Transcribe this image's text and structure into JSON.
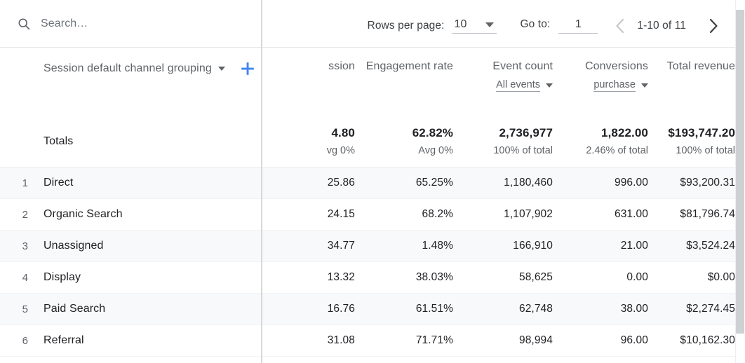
{
  "search": {
    "placeholder": "Search…",
    "value": "",
    "icon": "search-icon"
  },
  "pagination": {
    "rows_per_page_label": "Rows per page:",
    "rows_per_page_value": "10",
    "goto_label": "Go to:",
    "goto_value": "1",
    "range_text": "1-10 of 11",
    "prev_icon": "chevron-left-icon",
    "next_icon": "chevron-right-icon",
    "prev_enabled": false,
    "next_enabled": true
  },
  "dimension": {
    "label": "Session default channel grouping",
    "caret_icon": "chevron-down-icon",
    "add_icon": "plus-icon",
    "add_color": "#4285f4"
  },
  "columns": [
    {
      "header": "ssion",
      "sub": null,
      "clipped": true
    },
    {
      "header": "Engagement rate",
      "sub": null
    },
    {
      "header": "Event count",
      "sub": "All events"
    },
    {
      "header": "Conversions",
      "sub": "purchase"
    },
    {
      "header": "Total revenue",
      "sub": null
    }
  ],
  "totals": {
    "label": "Totals",
    "values": [
      "4.80",
      "62.82%",
      "2,736,977",
      "1,822.00",
      "$193,747.20"
    ],
    "subs": [
      "vg 0%",
      "Avg 0%",
      "100% of total",
      "2.46% of total",
      "100% of total"
    ]
  },
  "rows": [
    {
      "rank": "1",
      "dimension": "Direct",
      "values": [
        "25.86",
        "65.25%",
        "1,180,460",
        "996.00",
        "$93,200.31"
      ]
    },
    {
      "rank": "2",
      "dimension": "Organic Search",
      "values": [
        "24.15",
        "68.2%",
        "1,107,902",
        "631.00",
        "$81,796.74"
      ]
    },
    {
      "rank": "3",
      "dimension": "Unassigned",
      "values": [
        "34.77",
        "1.48%",
        "166,910",
        "21.00",
        "$3,524.24"
      ]
    },
    {
      "rank": "4",
      "dimension": "Display",
      "values": [
        "13.32",
        "38.03%",
        "58,625",
        "0.00",
        "$0.00"
      ]
    },
    {
      "rank": "5",
      "dimension": "Paid Search",
      "values": [
        "16.76",
        "61.51%",
        "62,748",
        "38.00",
        "$2,274.45"
      ]
    },
    {
      "rank": "6",
      "dimension": "Referral",
      "values": [
        "31.08",
        "71.71%",
        "98,994",
        "96.00",
        "$10,162.30"
      ]
    }
  ]
}
